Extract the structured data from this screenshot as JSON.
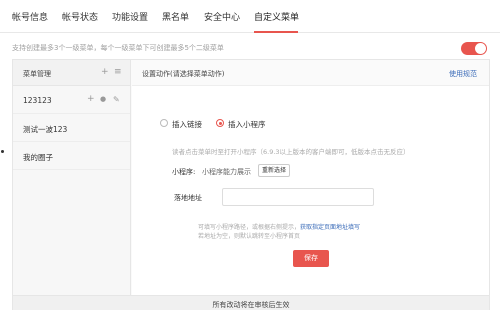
{
  "tabs": [
    {
      "label": "帐号信息"
    },
    {
      "label": "帐号状态"
    },
    {
      "label": "功能设置"
    },
    {
      "label": "黑名单"
    },
    {
      "label": "安全中心"
    },
    {
      "label": "自定义菜单",
      "active": true
    }
  ],
  "hint": "支持创建最多3个一级菜单，每个一级菜单下可创建最多5个二级菜单",
  "toggle": {
    "on": true
  },
  "menu_panel": {
    "title": "菜单管理",
    "items": [
      {
        "label": "123123"
      },
      {
        "label": "测试一波123"
      },
      {
        "label": "我的圈子"
      }
    ]
  },
  "action_panel": {
    "title": "设置动作(请选择菜单动作)",
    "help_link": "使用规范",
    "options": [
      {
        "label": "插入链接",
        "selected": false
      },
      {
        "label": "插入小程序",
        "selected": true
      }
    ],
    "description": "读者点击菜单时至打开小程序（6.9.3以上版本的客户端即可，低版本点击无反应）",
    "miniprogram_label": "小程序:",
    "miniprogram_value": "小程序能力展示",
    "reselect_button": "重新选择",
    "address_label": "落地地址",
    "address_value": "",
    "note_line1_prefix": "可填写小程序路径，或根据右侧提示，",
    "note_line1_link": "获取指定页面地址填写",
    "note_line2": "若地址为空，则默认跳转至小程序首页",
    "save_button": "保存"
  },
  "footer": "所有改动将在审核后生效",
  "colors": {
    "accent": "#e8554e",
    "link": "#3a6bb8"
  }
}
